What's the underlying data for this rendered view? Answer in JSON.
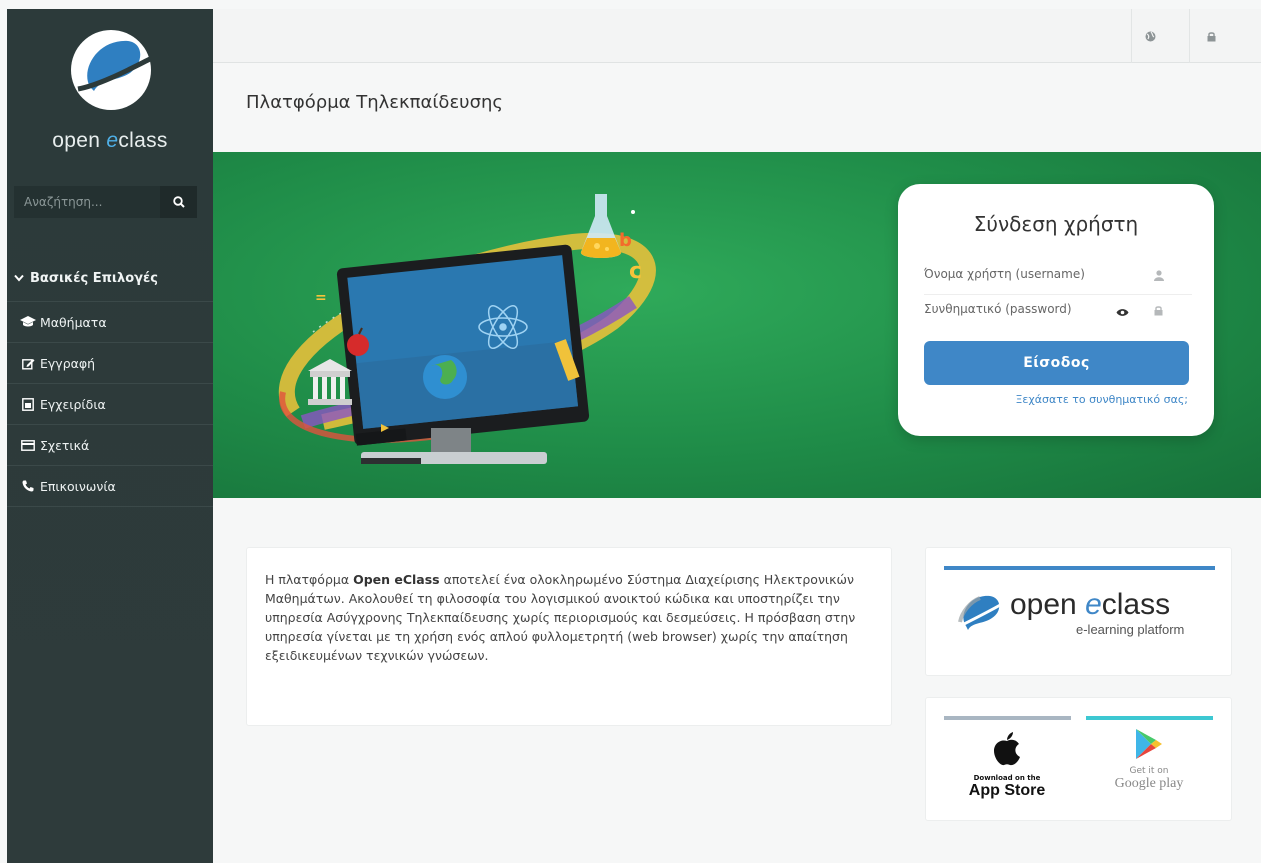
{
  "sidebar": {
    "logo_text_prefix": "open ",
    "logo_text_e": "e",
    "logo_text_suffix": "class",
    "search_placeholder": "Αναζήτηση...",
    "section_title": "Βασικές Επιλογές",
    "items": [
      {
        "label": "Μαθήματα",
        "icon": "graduation-cap-icon"
      },
      {
        "label": "Εγγραφή",
        "icon": "edit-icon"
      },
      {
        "label": "Εγχειρίδια",
        "icon": "document-icon"
      },
      {
        "label": "Σχετικά",
        "icon": "credit-card-icon"
      },
      {
        "label": "Επικοινωνία",
        "icon": "phone-icon"
      }
    ]
  },
  "topbar": {
    "icons": [
      "globe-icon",
      "lock-icon"
    ]
  },
  "page": {
    "title": "Πλατφόρμα Τηλεκπαίδευσης"
  },
  "login": {
    "title": "Σύνδεση χρήστη",
    "username_placeholder": "Όνομα χρήστη (username)",
    "password_placeholder": "Συνθηματικό (password)",
    "submit_label": "Είσοδος",
    "forgot_label": "Ξεχάσατε το συνθηματικό σας;"
  },
  "about": {
    "prefix": "Η πλατφόρμα ",
    "brand": "Open eClass",
    "text": " αποτελεί ένα ολοκληρωμένο Σύστημα Διαχείρισης Ηλεκτρονικών Μαθημάτων. Ακολουθεί τη φιλοσοφία του λογισμικού ανοικτού κώδικα και υποστηρίζει την υπηρεσία Ασύγχρονης Τηλεκπαίδευσης χωρίς περιορισμούς και δεσμεύσεις. Η πρόσβαση στην υπηρεσία γίνεται με τη χρήση ενός απλού φυλλομετρητή (web browser) χωρίς την απαίτηση εξειδικευμένων τεχνικών γνώσεων."
  },
  "brand_card": {
    "name_prefix": "open ",
    "name_e": "e",
    "name_suffix": "class",
    "tagline": "e-learning platform"
  },
  "apps": {
    "apple_small": "Download on the",
    "apple_big": "App Store",
    "google_small": "Get it on",
    "google_big": "Google play"
  },
  "colors": {
    "sidebar_bg": "#2c3a3a",
    "hero_green": "#1f8c48",
    "accent_blue": "#3f87c7",
    "google_bar": "#3dc8d2"
  }
}
